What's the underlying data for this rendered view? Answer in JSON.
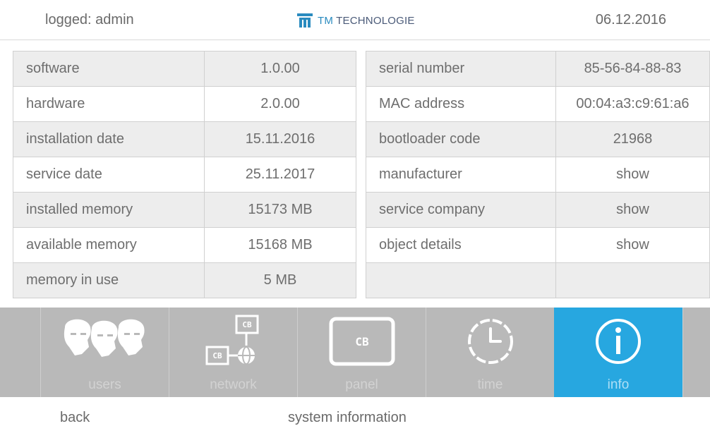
{
  "header": {
    "user_text": "logged: admin",
    "brand_prefix": "TM",
    "brand_name": "TECHNOLOGIE",
    "date": "06.12.2016"
  },
  "left_table": [
    {
      "label": "software",
      "value": "1.0.00"
    },
    {
      "label": "hardware",
      "value": "2.0.00"
    },
    {
      "label": "installation date",
      "value": "15.11.2016"
    },
    {
      "label": "service date",
      "value": "25.11.2017"
    },
    {
      "label": "installed memory",
      "value": "15173 MB"
    },
    {
      "label": "available memory",
      "value": "15168 MB"
    },
    {
      "label": "memory in use",
      "value": "5 MB"
    }
  ],
  "right_table": [
    {
      "label": "serial number",
      "value": "85-56-84-88-83"
    },
    {
      "label": "MAC address",
      "value": "00:04:a3:c9:61:a6"
    },
    {
      "label": "bootloader code",
      "value": "21968"
    },
    {
      "label": "manufacturer",
      "value": "show"
    },
    {
      "label": "service company",
      "value": "show"
    },
    {
      "label": "object details",
      "value": "show"
    },
    {
      "label": "",
      "value": ""
    }
  ],
  "nav": {
    "items": [
      {
        "label": "users",
        "icon": "users-icon"
      },
      {
        "label": "network",
        "icon": "network-icon",
        "icon_text": "CB"
      },
      {
        "label": "panel",
        "icon": "panel-icon",
        "icon_text": "CB"
      },
      {
        "label": "time",
        "icon": "clock-icon"
      },
      {
        "label": "info",
        "icon": "info-icon",
        "active": true
      }
    ]
  },
  "footer": {
    "back_label": "back",
    "page_title": "system information"
  },
  "colors": {
    "accent": "#27a7e0",
    "nav_bg": "#b9b9b9",
    "row_gray": "#ededed"
  }
}
